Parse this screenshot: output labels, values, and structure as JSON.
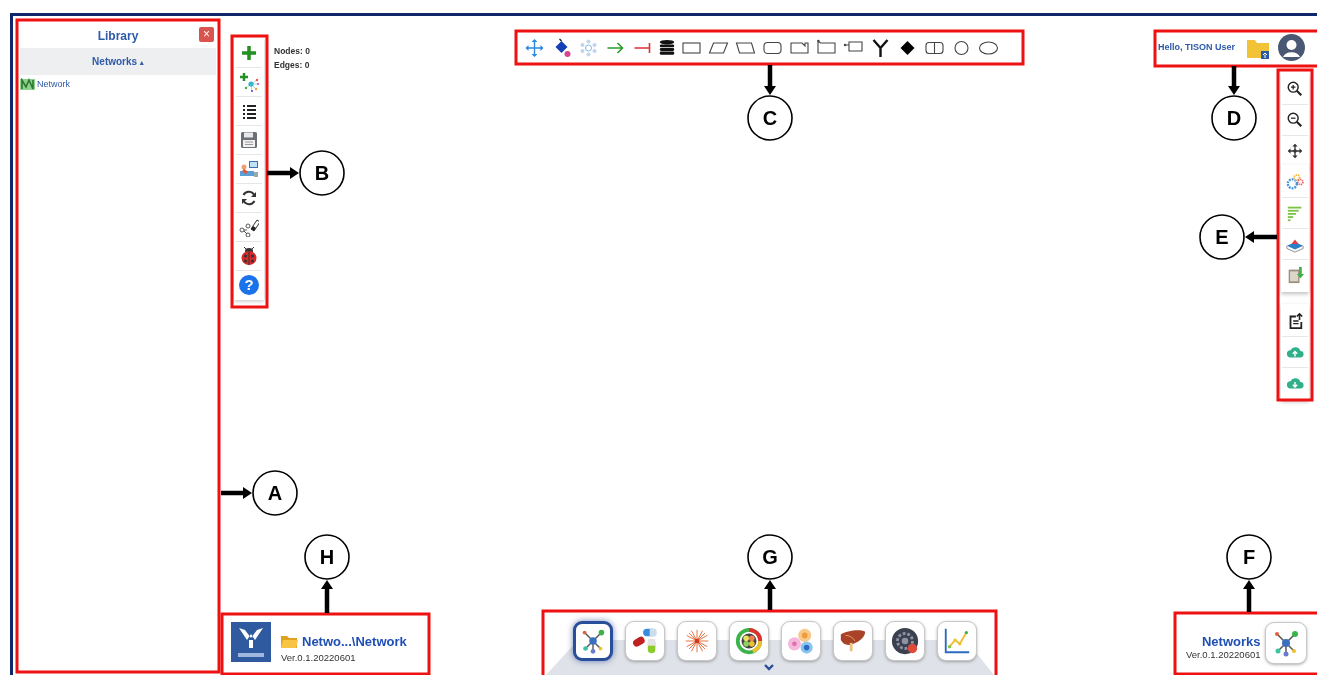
{
  "library": {
    "title": "Library",
    "close": "×",
    "tabs": [
      {
        "label": "Networks",
        "caret": "▴",
        "selected": true
      }
    ],
    "items": [
      {
        "label": "Network"
      }
    ]
  },
  "stats": [
    "Nodes: 0",
    "Edges: 0"
  ],
  "help": "?",
  "user": {
    "greeting": "Hello, TISON User"
  },
  "footer": {
    "path": "Netwo...\\Network",
    "version": "Ver.0.1.20220601"
  },
  "dock": [
    {
      "selected": true
    },
    {
      "selected": false
    },
    {
      "selected": false
    },
    {
      "selected": false
    },
    {
      "selected": false
    },
    {
      "selected": false
    },
    {
      "selected": false
    },
    {
      "selected": false
    }
  ],
  "app": {
    "name": "Networks",
    "version": "Ver.0.1.20220601"
  },
  "callouts": [
    {
      "label": "C"
    },
    {
      "label": "D"
    },
    {
      "label": "B"
    },
    {
      "label": "E"
    },
    {
      "label": "A"
    },
    {
      "label": "H"
    },
    {
      "label": "G"
    },
    {
      "label": "F"
    }
  ]
}
